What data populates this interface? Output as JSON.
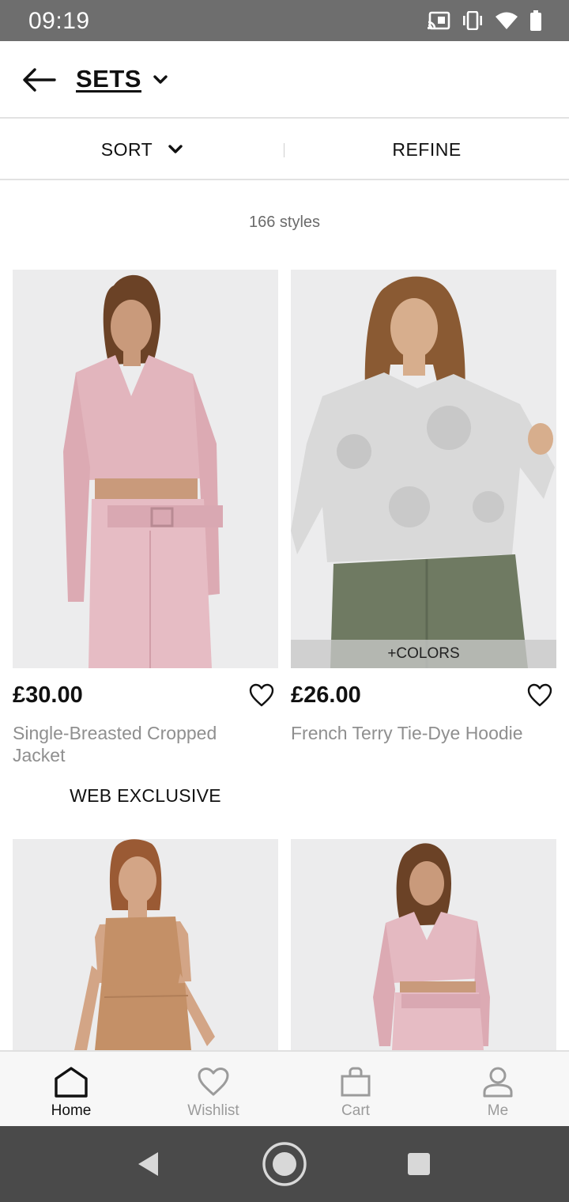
{
  "status_bar": {
    "time": "09:19",
    "icons": [
      "cast-icon",
      "vibrate-icon",
      "wifi-icon",
      "battery-icon"
    ]
  },
  "header": {
    "title": "SETS",
    "back_icon": "arrow-left-icon",
    "dropdown_icon": "chevron-down-icon"
  },
  "filter_bar": {
    "sort_label": "SORT",
    "refine_label": "REFINE"
  },
  "style_count": "166 styles",
  "products": [
    {
      "price": "£30.00",
      "name": "Single-Breasted Cropped Jacket",
      "badge": "WEB EXCLUSIVE",
      "colors_label": "",
      "image_colors": {
        "top": "#e2b5bd",
        "bottom": "#e6bcc4",
        "skin": "#c99a7b",
        "hair": "#6b4226"
      }
    },
    {
      "price": "£26.00",
      "name": "French Terry Tie-Dye Hoodie",
      "badge": "",
      "colors_label": "+COLORS",
      "image_colors": {
        "top": "#d9d9d9",
        "bottom": "#6f7a62",
        "skin": "#d7ae8d",
        "hair": "#8a5a33"
      }
    },
    {
      "price": "",
      "name": "",
      "badge": "",
      "colors_label": "",
      "image_colors": {
        "top": "#c49067",
        "bottom": "#c49067",
        "skin": "#d3a586",
        "hair": "#9a5a34"
      }
    },
    {
      "price": "",
      "name": "",
      "badge": "",
      "colors_label": "",
      "image_colors": {
        "top": "#e4b9c1",
        "bottom": "#e6bcc4",
        "skin": "#c99a7b",
        "hair": "#6b4226"
      }
    }
  ],
  "bottom_nav": {
    "items": [
      {
        "label": "Home",
        "icon": "home-icon",
        "active": true
      },
      {
        "label": "Wishlist",
        "icon": "heart-icon",
        "active": false
      },
      {
        "label": "Cart",
        "icon": "bag-icon",
        "active": false
      },
      {
        "label": "Me",
        "icon": "person-icon",
        "active": false
      }
    ]
  },
  "system_nav": {
    "icons": [
      "back-triangle-icon",
      "home-circle-icon",
      "recents-square-icon"
    ]
  }
}
